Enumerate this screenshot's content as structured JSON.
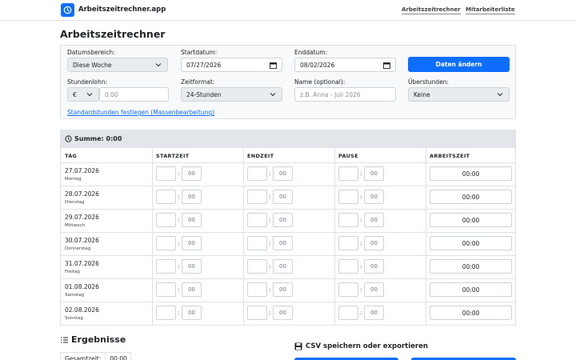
{
  "header": {
    "brand": "Arbeitszeitrechner.app",
    "nav": [
      "Arbeitszeitrechner",
      "Mitarbeiterliste"
    ]
  },
  "page_title": "Arbeitszeitrechner",
  "form": {
    "date_range_label": "Datumsbereich:",
    "date_range_value": "Diese Woche",
    "start_label": "Startdatum:",
    "start_value": "07/27/2026",
    "end_label": "Enddatum:",
    "end_value": "08/02/2026",
    "change_dates_button": "Daten ändern",
    "wage_label": "Stundenlohn:",
    "currency_value": "€",
    "wage_placeholder": "0.00",
    "time_format_label": "Zeitformat:",
    "time_format_value": "24-Stunden",
    "name_label": "Name (optional):",
    "name_placeholder": "z.B. Anna - Juli 2026",
    "overtime_label": "Überstunden:",
    "overtime_value": "Keine",
    "standard_hours_link": "Standardstunden festlegen (Massenbearbeitung)"
  },
  "table": {
    "sum_label": "Summe: 0:00",
    "headers": [
      "TAG",
      "STARTZEIT",
      "ENDZEIT",
      "PAUSE",
      "ARBEITSZEIT"
    ],
    "minute_placeholder": "00",
    "rows": [
      {
        "date": "27.07.2026",
        "weekday": "Montag",
        "worktime": "00:00"
      },
      {
        "date": "28.07.2026",
        "weekday": "Dienstag",
        "worktime": "00:00"
      },
      {
        "date": "29.07.2026",
        "weekday": "Mittwoch",
        "worktime": "00:00"
      },
      {
        "date": "30.07.2026",
        "weekday": "Donnerstag",
        "worktime": "00:00"
      },
      {
        "date": "31.07.2026",
        "weekday": "Freitag",
        "worktime": "00:00"
      },
      {
        "date": "01.08.2026",
        "weekday": "Samstag",
        "worktime": "00:00"
      },
      {
        "date": "02.08.2026",
        "weekday": "Sonntag",
        "worktime": "00:00"
      }
    ]
  },
  "results": {
    "title": "Ergebnisse",
    "total_label": "Gesamtzeit:",
    "total_value": "00:00"
  },
  "csv": {
    "title": "CSV speichern oder exportieren"
  },
  "colors": {
    "primary": "#0d6efd",
    "sum_bar": "#e2e6ea",
    "form_bg": "#f8f9fa"
  }
}
